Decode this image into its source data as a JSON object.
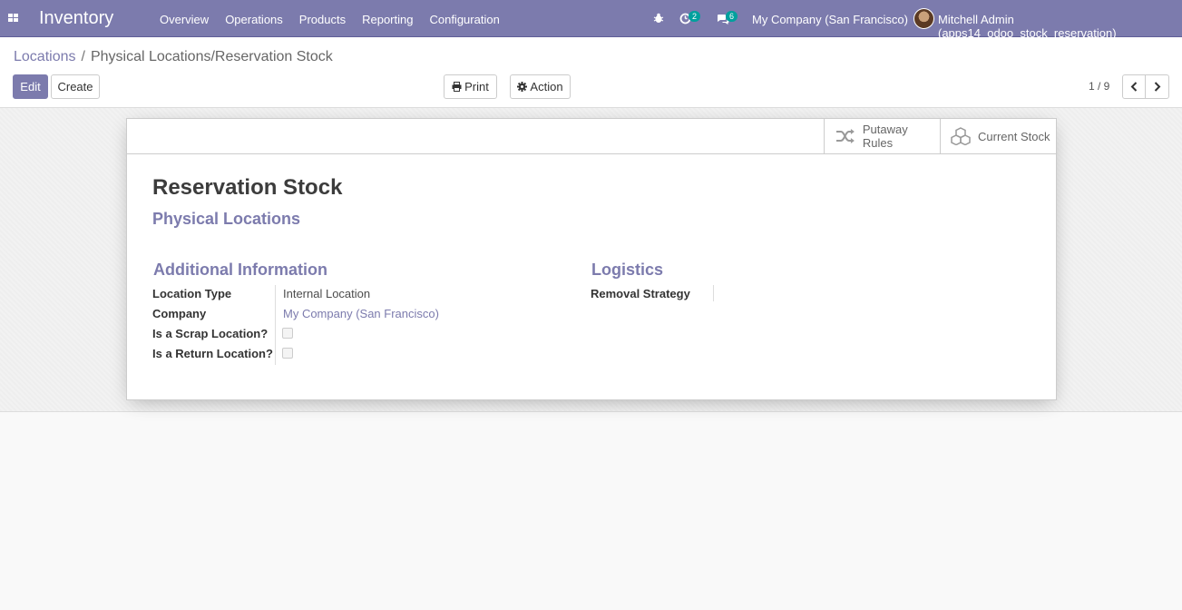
{
  "navbar": {
    "app_name": "Inventory",
    "menu": [
      "Overview",
      "Operations",
      "Products",
      "Reporting",
      "Configuration"
    ],
    "activity_count": "2",
    "message_count": "6",
    "company": "My Company (San Francisco)",
    "user": "Mitchell Admin (apps14_odoo_stock_reservation)"
  },
  "breadcrumb": {
    "parent": "Locations",
    "current": "Physical Locations/Reservation Stock"
  },
  "toolbar": {
    "edit_label": "Edit",
    "create_label": "Create",
    "print_label": "Print",
    "action_label": "Action",
    "pager": "1 / 9"
  },
  "smart_buttons": {
    "putaway_rules": "Putaway Rules",
    "current_stock": "Current Stock"
  },
  "record": {
    "name": "Reservation Stock",
    "parent_location": "Physical Locations"
  },
  "groups": {
    "additional_info": {
      "title": "Additional Information",
      "fields": {
        "location_type_label": "Location Type",
        "location_type_value": "Internal Location",
        "company_label": "Company",
        "company_value": "My Company (San Francisco)",
        "scrap_label": "Is a Scrap Location?",
        "return_label": "Is a Return Location?"
      }
    },
    "logistics": {
      "title": "Logistics",
      "removal_strategy_label": "Removal Strategy",
      "removal_strategy_value": ""
    }
  },
  "colors": {
    "brand": "#7c7bad",
    "badge": "#00a09d"
  }
}
